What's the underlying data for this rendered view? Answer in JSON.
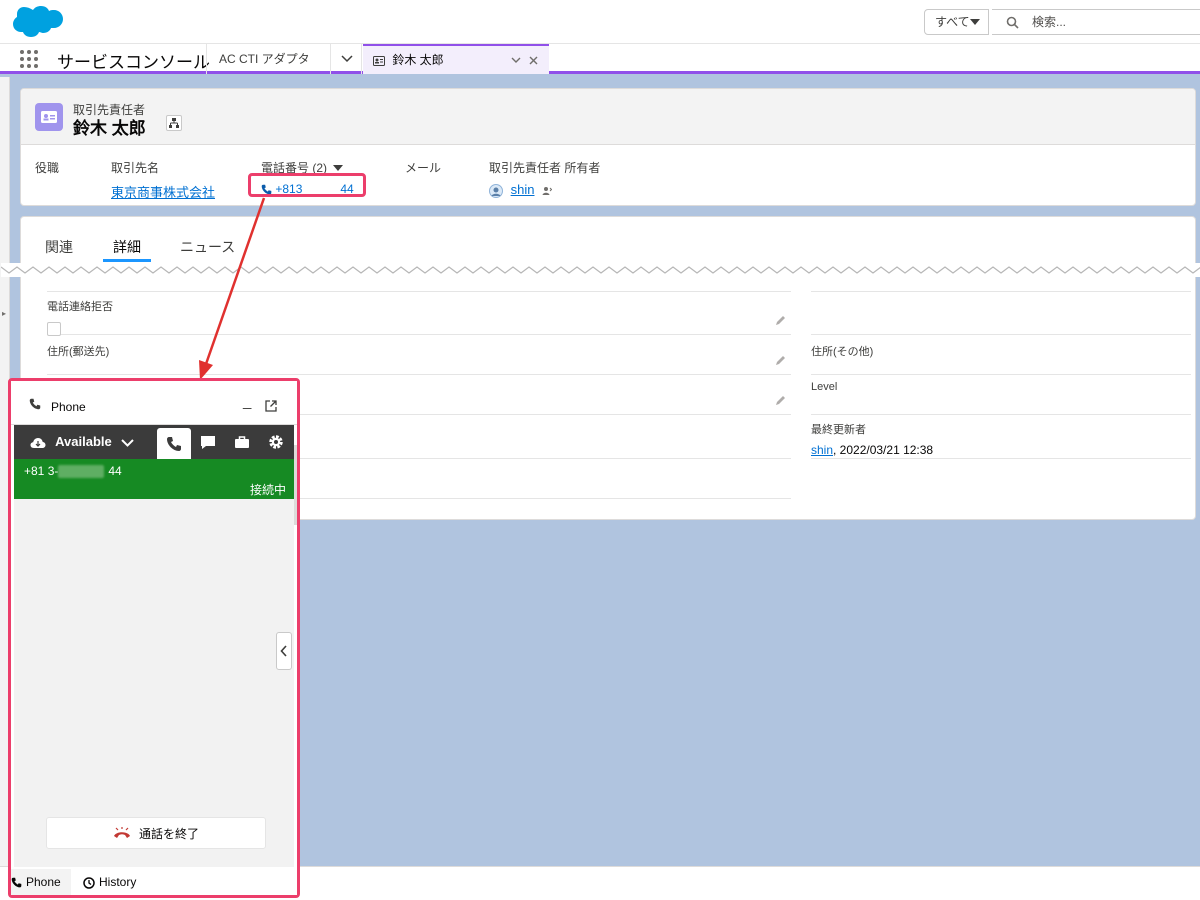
{
  "global_header": {
    "search_scope": "すべて",
    "search_placeholder": "検索..."
  },
  "nav": {
    "app_name": "サービスコンソール",
    "tabs": [
      {
        "label": "AC CTI アダプタ"
      },
      {
        "label": "鈴木 太郎"
      }
    ]
  },
  "record": {
    "object_type": "取引先責任者",
    "name": "鈴木 太郎",
    "fields": [
      {
        "label": "役職",
        "value": ""
      },
      {
        "label": "取引先名",
        "value": "東京商事株式会社"
      },
      {
        "label": "電話番号 (2)",
        "value_prefix": "+813",
        "value_suffix": "44"
      },
      {
        "label": "メール",
        "value": ""
      },
      {
        "label": "取引先責任者 所有者",
        "value": "shin"
      }
    ]
  },
  "detail": {
    "tabs": [
      "関連",
      "詳細",
      "ニュース"
    ],
    "active_tab": "詳細",
    "rows": [
      {
        "label": "電話連絡拒否"
      },
      {
        "label": "住所(郵送先)"
      },
      {
        "label": "住所(その他)"
      },
      {
        "label": "Level"
      },
      {
        "label": "最終更新者",
        "user": "shin",
        "timestamp": ", 2022/03/21 12:38"
      }
    ]
  },
  "softphone": {
    "title": "Phone",
    "status": "Available",
    "call_number_prefix": "+81 3-",
    "call_number_suffix": "44",
    "call_status": "接続中",
    "end_call_label": "通話を終了",
    "footer_tabs": [
      "Phone",
      "History"
    ]
  },
  "colors": {
    "accent_purple": "#9050e9",
    "highlight_pink": "#ec3e6b",
    "link_blue": "#0070d2",
    "call_green": "#168a23",
    "toolbar_dark": "#3b3b3b",
    "workspace_blue": "#b0c4df"
  }
}
